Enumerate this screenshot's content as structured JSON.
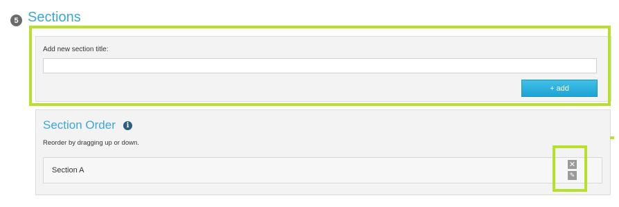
{
  "header": {
    "step_number": "5",
    "title": "Sections"
  },
  "add_section": {
    "label": "Add new section title:",
    "input_value": "",
    "input_placeholder": "",
    "button_label": "+ add"
  },
  "section_order": {
    "title": "Section Order",
    "info_icon": "info-icon",
    "hint": "Reorder by dragging up or down.",
    "items": [
      {
        "label": "Section A"
      }
    ]
  },
  "icons": {
    "delete": "close-icon",
    "edit": "edit-icon",
    "info": "info-icon"
  },
  "colors": {
    "accent": "#3aa7d9",
    "button": "#1ea3d3",
    "highlight": "#b6e02a",
    "badge": "#6b6b6b"
  }
}
